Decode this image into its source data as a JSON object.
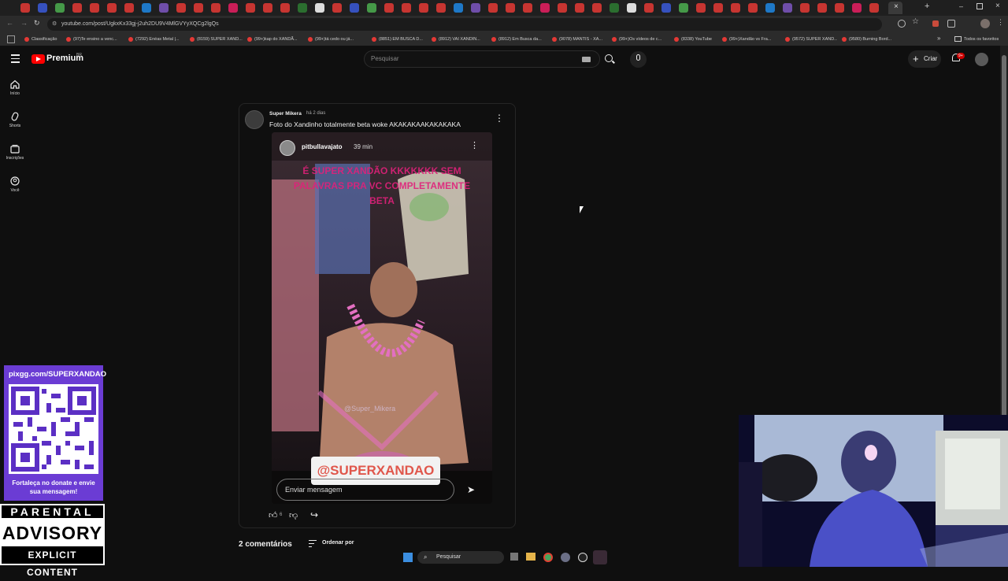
{
  "browser": {
    "url": "youtube.com/post/UgkxKx33gj-j2uh2DU9V4MlGVYyXQCg2lgQs",
    "bookmarks": [
      "Classificação",
      "(97)Te ensino a venc...",
      "(7292) Enéas Metal |...",
      "(8159) SUPER XAND...",
      "(99+)kap do XANDÃ...",
      "(99+)tá cedo ou já...",
      "(8851) EM BUSCA D...",
      "(8912) VAI XANDIN...",
      "(8912) Em Busca da...",
      "(9078) MANTIS - XA...",
      "(99+)Os vídeos de c...",
      "(8338) YouTube",
      "(99+)Xandão vs Fra...",
      "(9572) SUPER XAND...",
      "(9580) Burning Bord..."
    ],
    "bookmarks_folder": "Todos os favoritos"
  },
  "header": {
    "logo": "Premium",
    "logo_region": "BR",
    "search_placeholder": "Pesquisar",
    "create_label": "Criar",
    "notification_count": "9+"
  },
  "sidebar": {
    "items": [
      {
        "label": "Início",
        "icon": "home-icon"
      },
      {
        "label": "Shorts",
        "icon": "shorts-icon"
      },
      {
        "label": "Inscrições",
        "icon": "subscriptions-icon"
      },
      {
        "label": "Você",
        "icon": "you-icon"
      }
    ]
  },
  "post": {
    "author": "Super Mikera",
    "time": "há 2 dias",
    "text": "Foto do Xandinho totalmente beta woke AKAKAKAAKAKAKAKA",
    "likes": "6",
    "story": {
      "username": "pitbullavajato",
      "time": "39 min",
      "overlay_text": "É SUPER XANDÃO KKKKKKK SEM PALAVRAS PRA VC COMPLETAMENTE BETA",
      "watermark": "@Super_Mikera",
      "sticker": "@SUPERXANDAO",
      "reply_placeholder": "Enviar mensagem"
    }
  },
  "comments": {
    "count_label": "2 comentários",
    "sort_label": "Ordenar por"
  },
  "qr_panel": {
    "url": "pixgg.com/SUPERXANDAO",
    "caption": "Fortaleça no donate e envie sua mensagem!"
  },
  "advisory": {
    "line1": "PARENTAL",
    "line2": "ADVISORY",
    "line3": "EXPLICIT CONTENT"
  },
  "taskbar": {
    "search": "Pesquisar"
  },
  "colors": {
    "youtube_red": "#ff0000",
    "qr_panel": "#6b3cd4",
    "overlay_pink": "#e0217a"
  }
}
